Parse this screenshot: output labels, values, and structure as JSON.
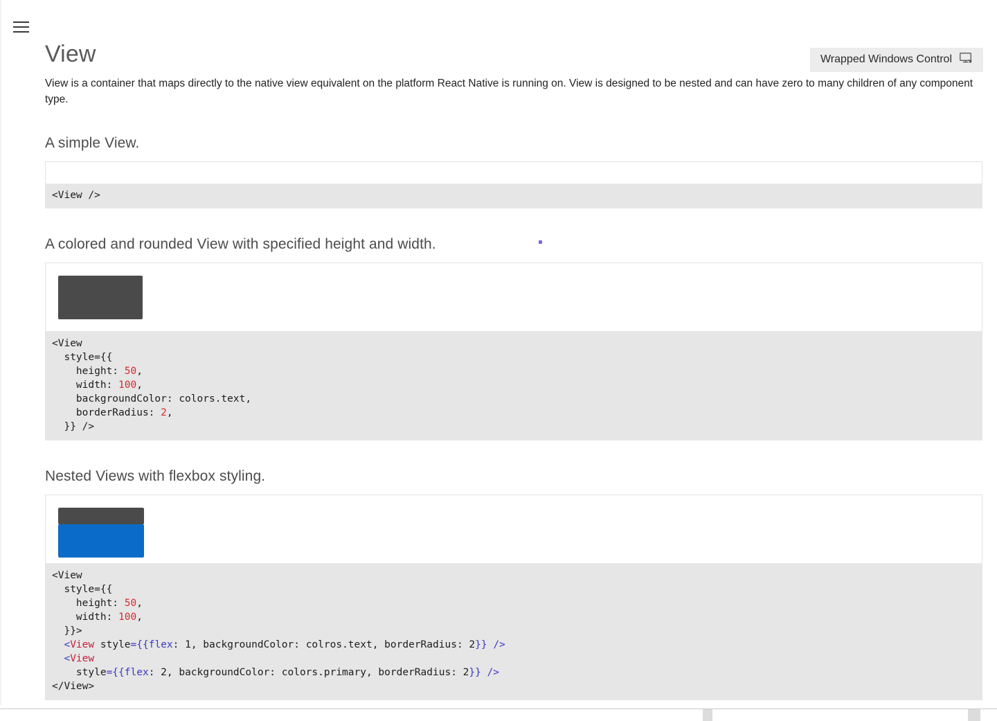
{
  "window": {
    "hamburger_icon": "hamburger-menu-icon"
  },
  "header": {
    "title": "View",
    "control_chip": {
      "label": "Wrapped Windows Control",
      "icon": "monitor-icon"
    }
  },
  "description": "View is a container that maps directly to the native view equivalent on the platform React Native is running on. View is designed to be nested and can have zero to many children of any component type.",
  "colors": {
    "code_background": "#e6e6e6",
    "demo_dark": "#4a4a4a",
    "demo_primary": "#0a6cc8",
    "chip_background": "#ececec",
    "number_token": "#d62b2b",
    "tag_token": "#c4213b",
    "punctuation_token": "#3b37c8"
  },
  "sections": [
    {
      "heading": "A simple View.",
      "preview": "empty",
      "code_lines": [
        [
          {
            "t": "<View />",
            "c": "plain"
          }
        ]
      ]
    },
    {
      "heading": "A colored and rounded View with specified height and width.",
      "preview": "single-box",
      "code_lines": [
        [
          {
            "t": "<View",
            "c": "plain"
          }
        ],
        [
          {
            "t": "  style={{",
            "c": "plain"
          }
        ],
        [
          {
            "t": "    height: ",
            "c": "plain"
          },
          {
            "t": "50",
            "c": "num"
          },
          {
            "t": ",",
            "c": "plain"
          }
        ],
        [
          {
            "t": "    width: ",
            "c": "plain"
          },
          {
            "t": "100",
            "c": "num"
          },
          {
            "t": ",",
            "c": "plain"
          }
        ],
        [
          {
            "t": "    backgroundColor: colors.text,",
            "c": "plain"
          }
        ],
        [
          {
            "t": "    borderRadius: ",
            "c": "plain"
          },
          {
            "t": "2",
            "c": "num"
          },
          {
            "t": ",",
            "c": "plain"
          }
        ],
        [
          {
            "t": "  }} />",
            "c": "plain"
          }
        ]
      ]
    },
    {
      "heading": "Nested Views with flexbox styling.",
      "preview": "nested-box",
      "code_lines": [
        [
          {
            "t": "<View",
            "c": "plain"
          }
        ],
        [
          {
            "t": "  style={{",
            "c": "plain"
          }
        ],
        [
          {
            "t": "    height: ",
            "c": "plain"
          },
          {
            "t": "50",
            "c": "num"
          },
          {
            "t": ",",
            "c": "plain"
          }
        ],
        [
          {
            "t": "    width: ",
            "c": "plain"
          },
          {
            "t": "100",
            "c": "num"
          },
          {
            "t": ",",
            "c": "plain"
          }
        ],
        [
          {
            "t": "  }}>",
            "c": "plain"
          }
        ],
        [
          {
            "t": "  ",
            "c": "plain"
          },
          {
            "t": "<",
            "c": "punc"
          },
          {
            "t": "View",
            "c": "tag"
          },
          {
            "t": " style",
            "c": "plain"
          },
          {
            "t": "={{",
            "c": "punc"
          },
          {
            "t": "flex",
            "c": "attr"
          },
          {
            "t": ": 1, backgroundColor: colros.text, borderRadius: 2",
            "c": "plain"
          },
          {
            "t": "}} />",
            "c": "punc"
          }
        ],
        [
          {
            "t": "  ",
            "c": "plain"
          },
          {
            "t": "<",
            "c": "punc"
          },
          {
            "t": "View",
            "c": "tag"
          }
        ],
        [
          {
            "t": "    style",
            "c": "plain"
          },
          {
            "t": "={{",
            "c": "punc"
          },
          {
            "t": "flex",
            "c": "attr"
          },
          {
            "t": ": 2, backgroundColor: colors.primary, borderRadius: 2",
            "c": "plain"
          },
          {
            "t": "}} />",
            "c": "punc"
          }
        ],
        [
          {
            "t": "</View>",
            "c": "plain"
          }
        ]
      ]
    }
  ]
}
